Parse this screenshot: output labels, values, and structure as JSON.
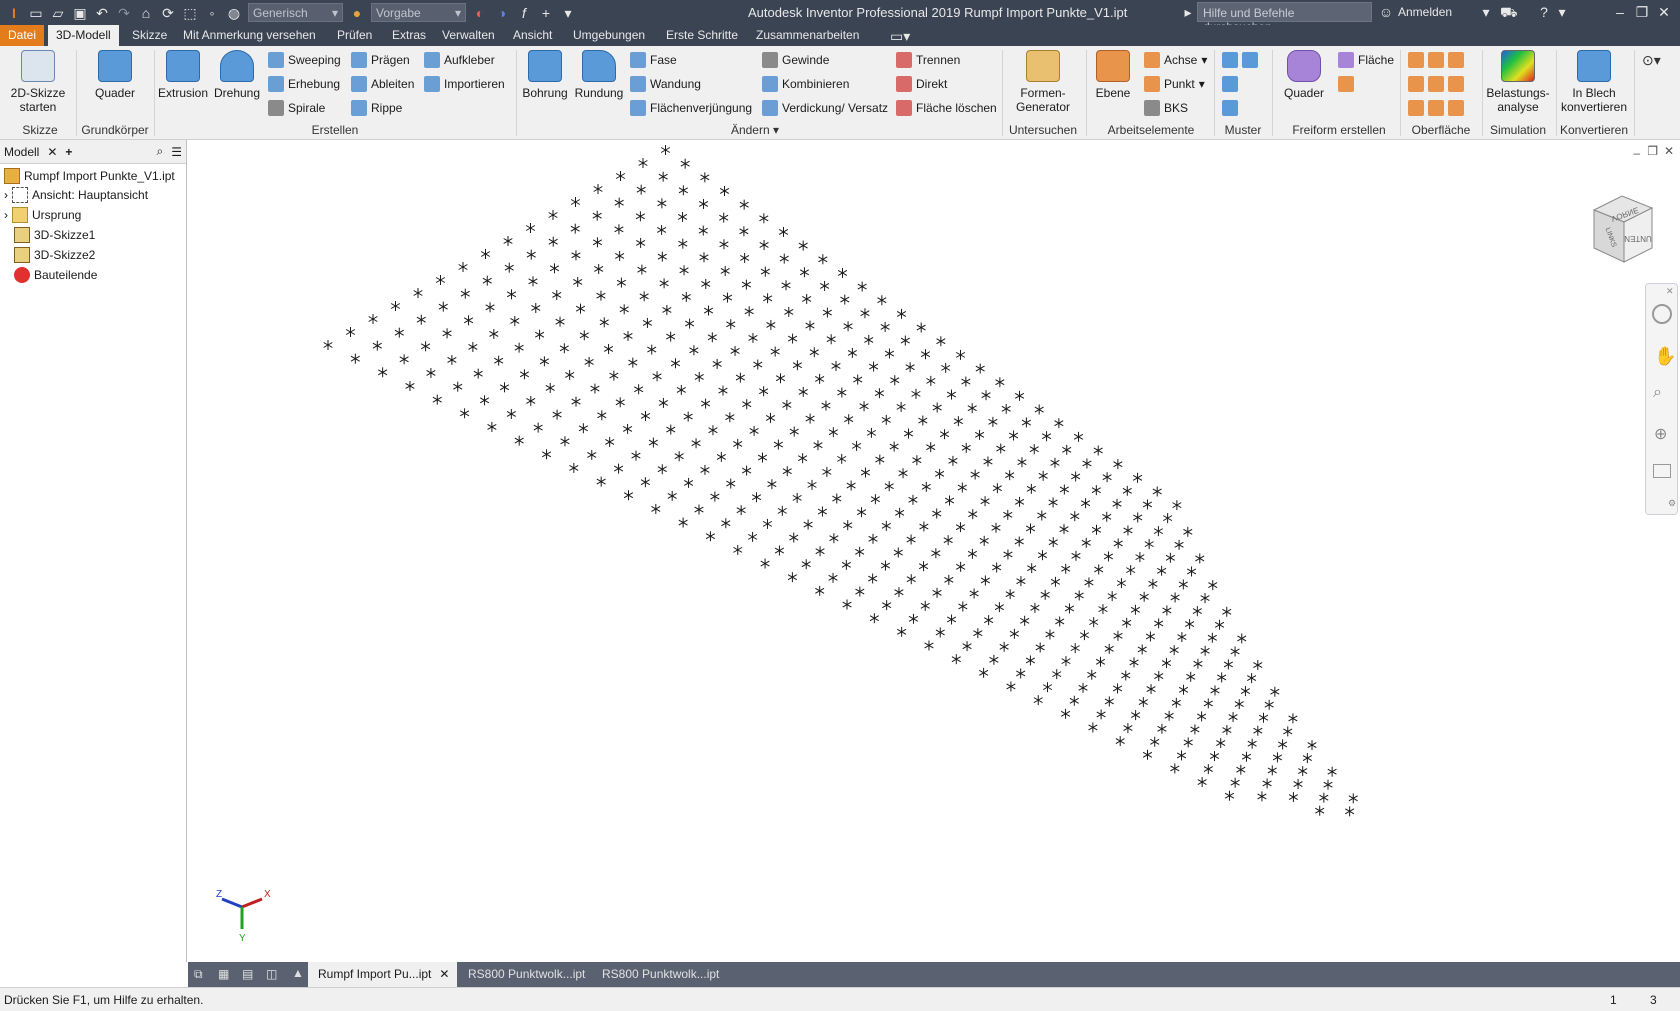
{
  "title": "Autodesk Inventor Professional 2019    Rumpf Import Punkte_V1.ipt",
  "quick_access": {
    "material_combo": "Generisch",
    "appearance_combo": "Vorgabe"
  },
  "search": {
    "placeholder": "Hilfe und Befehle durchsuchen..."
  },
  "account": {
    "label": "Anmelden"
  },
  "menu_tabs": [
    "Datei",
    "3D-Modell",
    "Skizze",
    "Mit Anmerkung versehen",
    "Prüfen",
    "Extras",
    "Verwalten",
    "Ansicht",
    "Umgebungen",
    "Erste Schritte",
    "Zusammenarbeiten"
  ],
  "ribbon": {
    "skizze": {
      "btn": "2D-Skizze starten",
      "label": "Skizze"
    },
    "grundkoerper": {
      "btn": "Quader",
      "label": "Grundkörper"
    },
    "erstellen": {
      "label": "Erstellen",
      "extrusion": "Extrusion",
      "drehung": "Drehung",
      "sweeping": "Sweeping",
      "erhebung": "Erhebung",
      "spirale": "Spirale",
      "praegen": "Prägen",
      "ableiten": "Ableiten",
      "rippe": "Rippe",
      "aufkleber": "Aufkleber",
      "importieren": "Importieren"
    },
    "aendern": {
      "label": "Ändern",
      "bohrung": "Bohrung",
      "rundung": "Rundung",
      "fase": "Fase",
      "wandung": "Wandung",
      "flaechenverjuengung": "Flächenverjüngung",
      "gewinde": "Gewinde",
      "kombinieren": "Kombinieren",
      "verdickung": "Verdickung/ Versatz",
      "trennen": "Trennen",
      "direkt": "Direkt",
      "flaeche_loeschen": "Fläche löschen"
    },
    "untersuchen": {
      "btn": "Formen-Generator",
      "label": "Untersuchen"
    },
    "arbeitselemente": {
      "ebene": "Ebene",
      "achse": "Achse",
      "punkt": "Punkt",
      "bks": "BKS",
      "label": "Arbeitselemente"
    },
    "muster": {
      "label": "Muster"
    },
    "freiform": {
      "btn": "Quader",
      "flaeche": "Fläche",
      "label": "Freiform erstellen"
    },
    "oberflaeche": {
      "label": "Oberfläche"
    },
    "simulation": {
      "btn": "Belastungs-analyse",
      "label": "Simulation"
    },
    "konvertieren": {
      "btn": "In Blech konvertieren",
      "label": "Konvertieren"
    }
  },
  "browser": {
    "tab_label": "Modell",
    "items": [
      {
        "label": "Rumpf Import Punkte_V1.ipt"
      },
      {
        "label": "Ansicht: Hauptansicht"
      },
      {
        "label": "Ursprung"
      },
      {
        "label": "3D-Skizze1"
      },
      {
        "label": "3D-Skizze2"
      },
      {
        "label": "Bauteilende"
      }
    ]
  },
  "viewcube": {
    "top": "VORNE",
    "side": "LINKS",
    "front": "UNTEN"
  },
  "triad": {
    "x": "X",
    "y": "Y",
    "z": "Z"
  },
  "doc_tabs": [
    "Rumpf Import Pu...ipt",
    "RS800 Punktwolk...ipt",
    "RS800 Punktwolk...ipt"
  ],
  "status": {
    "hint": "Drücken Sie F1, um Hilfe zu erhalten.",
    "num1": "1",
    "num2": "3"
  },
  "colors": {
    "titlebar": "#3b4453",
    "accent": "#e37d1b",
    "ribbon_bg": "#f0f0f0"
  }
}
